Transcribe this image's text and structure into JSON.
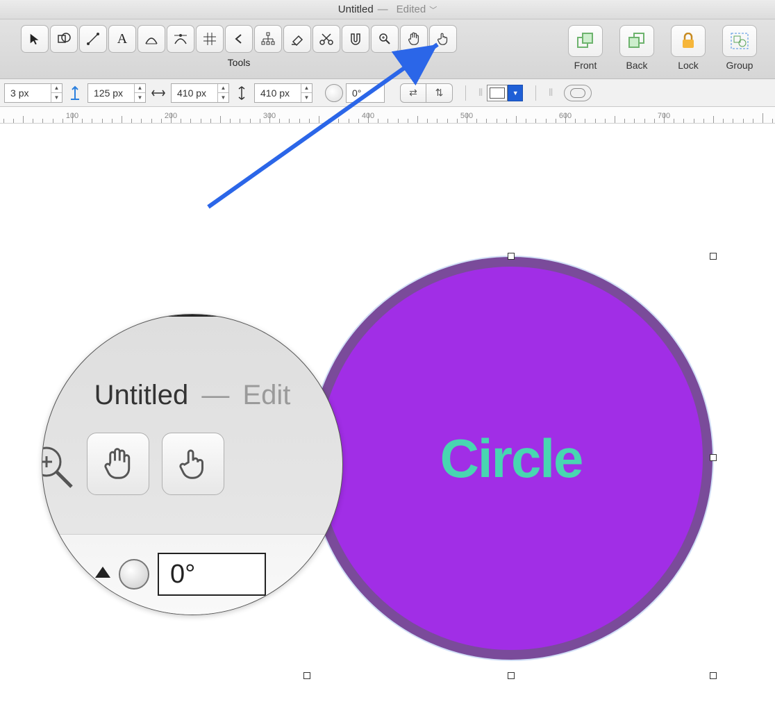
{
  "title": {
    "doc": "Untitled",
    "separator": "—",
    "status": "Edited"
  },
  "toolbar": {
    "label": "Tools",
    "tools": [
      "selection",
      "shape",
      "line",
      "text",
      "bezier",
      "edit-points",
      "grid",
      "back-arrow",
      "hierarchy",
      "eraser",
      "scissors",
      "magnet",
      "zoom",
      "hand",
      "action-click"
    ],
    "right": {
      "front": "Front",
      "back": "Back",
      "lock": "Lock",
      "group": "Group"
    }
  },
  "properties": {
    "x": {
      "value": "3",
      "unit": "px"
    },
    "y": {
      "value": "125",
      "unit": "px"
    },
    "w": {
      "value": "410",
      "unit": "px"
    },
    "h": {
      "value": "410",
      "unit": "px"
    },
    "angle": "0°"
  },
  "ruler": {
    "marks": [
      100,
      200,
      300,
      400,
      500,
      600,
      700
    ]
  },
  "shape": {
    "label": "Circle"
  },
  "lens": {
    "title_doc": "Untitled",
    "title_sep": "—",
    "title_status": "Edit",
    "angle": "0°"
  }
}
